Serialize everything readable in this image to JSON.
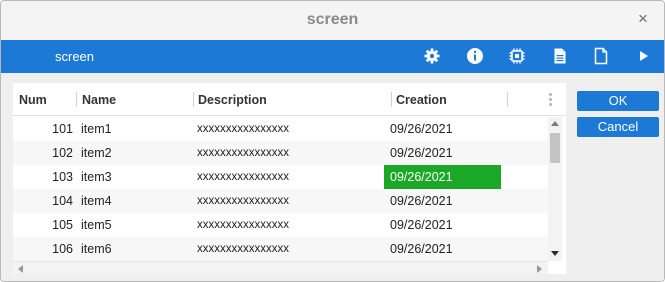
{
  "window": {
    "title": "screen",
    "close_symbol": "×"
  },
  "toolbar": {
    "title": "screen",
    "icons": [
      "gear-icon",
      "info-icon",
      "chip-icon",
      "document-text-icon",
      "document-blank-icon",
      "play-icon"
    ],
    "background": "#1c7ad6"
  },
  "table": {
    "columns": [
      "Num",
      "Name",
      "Description",
      "Creation"
    ],
    "rows": [
      {
        "num": "101",
        "name": "item1",
        "description": "xxxxxxxxxxxxxxxx",
        "creation": "09/26/2021"
      },
      {
        "num": "102",
        "name": "item2",
        "description": "xxxxxxxxxxxxxxxx",
        "creation": "09/26/2021"
      },
      {
        "num": "103",
        "name": "item3",
        "description": "xxxxxxxxxxxxxxxx",
        "creation": "09/26/2021"
      },
      {
        "num": "104",
        "name": "item4",
        "description": "xxxxxxxxxxxxxxxx",
        "creation": "09/26/2021"
      },
      {
        "num": "105",
        "name": "item5",
        "description": "xxxxxxxxxxxxxxxx",
        "creation": "09/26/2021"
      },
      {
        "num": "106",
        "name": "item6",
        "description": "xxxxxxxxxxxxxxxx",
        "creation": "09/26/2021"
      }
    ],
    "selected_row": 2,
    "selected_column": "creation",
    "selected_color": "#1ba826"
  },
  "buttons": {
    "ok": "OK",
    "cancel": "Cancel"
  }
}
